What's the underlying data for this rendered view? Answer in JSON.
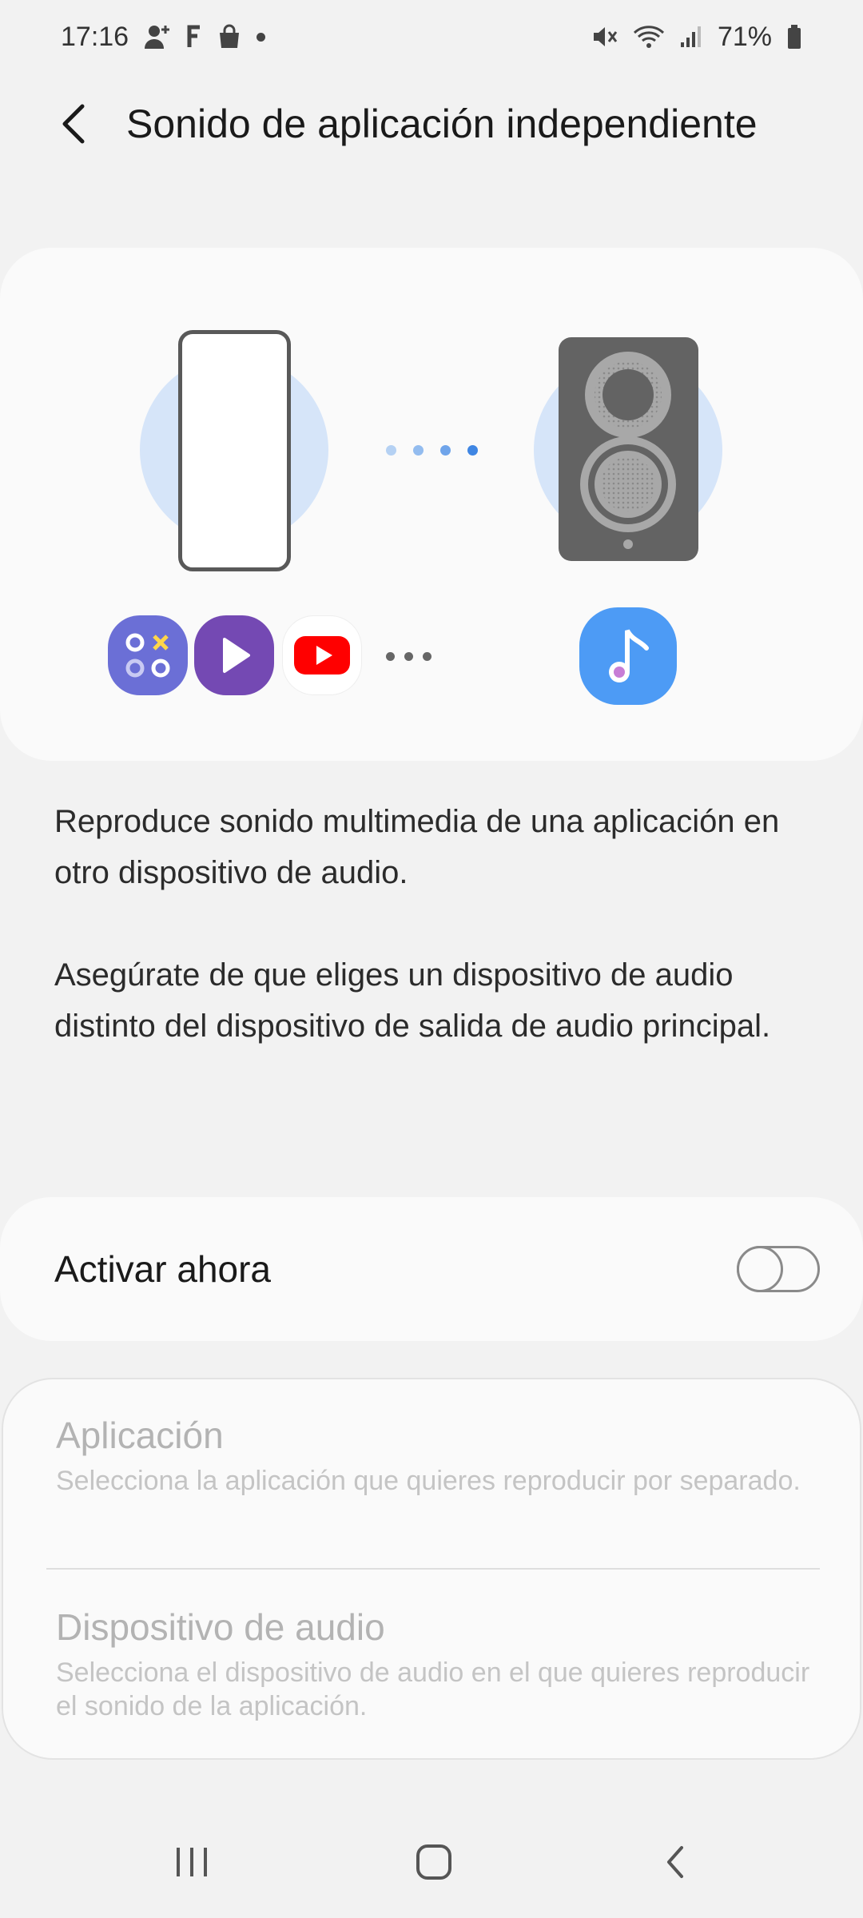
{
  "status_bar": {
    "time": "17:16",
    "battery": "71%",
    "icons_left": [
      "person-add-icon",
      "f-icon",
      "shopping-bag-icon",
      "notification-dot-icon"
    ],
    "icons_right": [
      "mute-icon",
      "wifi-icon",
      "signal-icon",
      "battery-icon"
    ]
  },
  "header": {
    "back_icon": "chevron-left-icon",
    "title": "Sonido de aplicación independiente"
  },
  "illustration": {
    "left_device": "phone-icon",
    "right_device": "speaker-icon",
    "connection_dot_colors": [
      "#b5d1f3",
      "#93bcef",
      "#6fa4ea",
      "#3f86e3"
    ],
    "apps": [
      "game-launcher-icon",
      "play-icon",
      "youtube-icon"
    ],
    "more_label": "more-dots-icon",
    "target_app": "music-note-icon",
    "colors": {
      "circle": "#d6e5f9",
      "speaker": "#636363",
      "game_launcher": "#6b6fd6",
      "play": "#7449b3",
      "youtube": "#ff0000",
      "music": "#4d9bf5"
    }
  },
  "description": {
    "p1": "Reproduce sonido multimedia de una aplicación en otro dispositivo de audio.",
    "p2": "Asegúrate de que eliges un dispositivo de audio distinto del dispositivo de salida de audio principal."
  },
  "toggle": {
    "label": "Activar ahora",
    "checked": false
  },
  "settings": {
    "app": {
      "title": "Aplicación",
      "subtitle": "Selecciona la aplicación que quieres reproducir por separado."
    },
    "audio_device": {
      "title": "Dispositivo de audio",
      "subtitle": "Selecciona el dispositivo de audio en el que quieres reproducir el sonido de la aplicación."
    }
  },
  "nav_bar": {
    "items": [
      "recent-apps-icon",
      "home-icon",
      "back-icon"
    ]
  }
}
